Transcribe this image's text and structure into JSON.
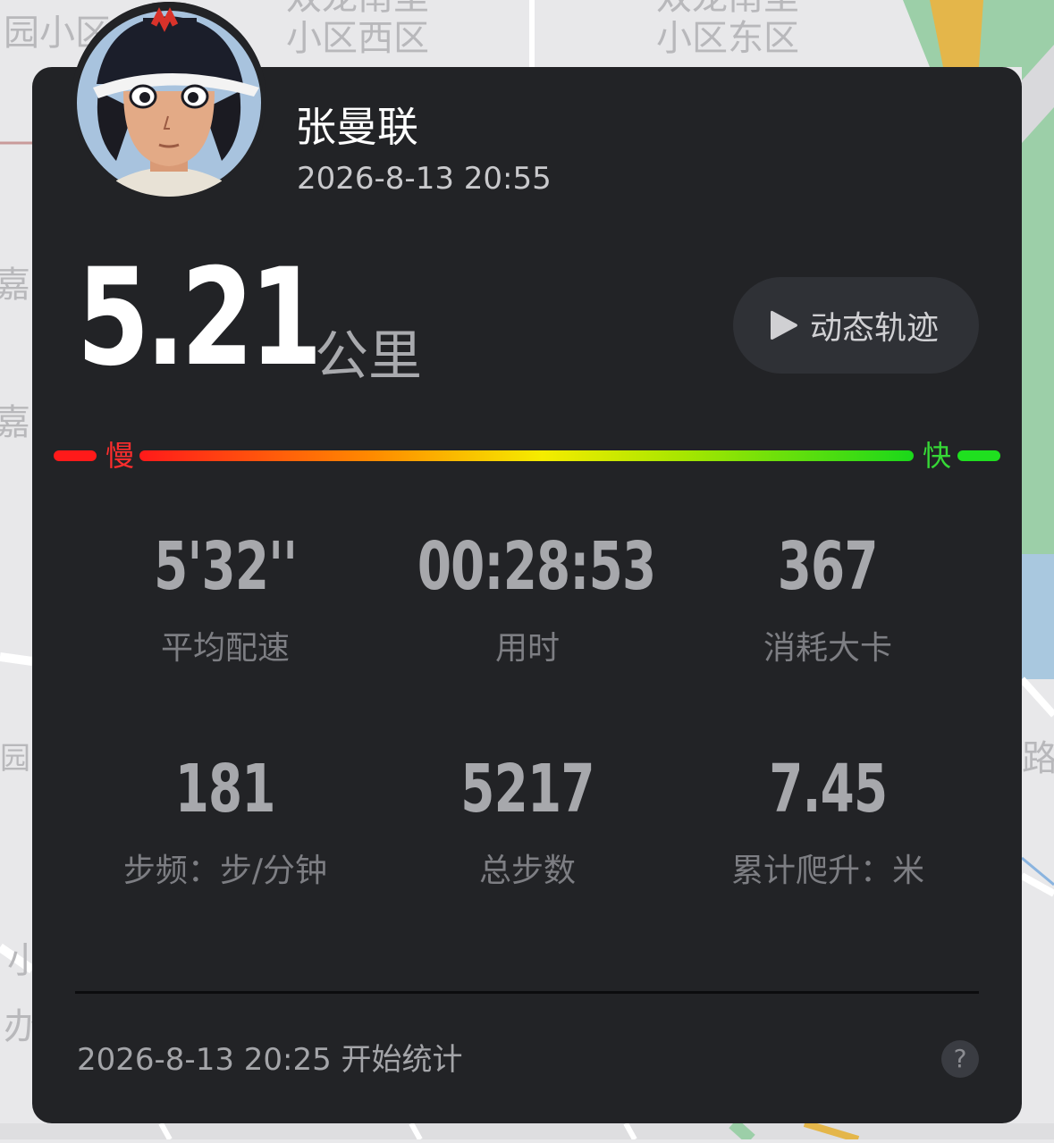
{
  "map": {
    "labels": [
      "园小区",
      "双龙南里\n小区西区",
      "双龙南里\n小区东区",
      "嘉园",
      "嘉园",
      "园",
      "路",
      "小",
      "办"
    ]
  },
  "user": {
    "name": "张曼联",
    "timestamp": "2026-8-13 20:55"
  },
  "distance": {
    "value": "5.21",
    "unit": "公里"
  },
  "replay_button": {
    "label": "动态轨迹",
    "icon": "play-icon"
  },
  "speed_legend": {
    "slow_label": "慢",
    "fast_label": "快",
    "slow_color": "#ff1a1a",
    "fast_color": "#1fe01f"
  },
  "stats": [
    {
      "value": "5'32''",
      "label": "平均配速"
    },
    {
      "value": "00:28:53",
      "label": "用时"
    },
    {
      "value": "367",
      "label": "消耗大卡"
    },
    {
      "value": "181",
      "label": "步频：步/分钟"
    },
    {
      "value": "5217",
      "label": "总步数"
    },
    {
      "value": "7.45",
      "label": "累计爬升：米"
    }
  ],
  "footer": {
    "start_text": "2026-8-13 20:25 开始统计",
    "help_label": "?"
  }
}
